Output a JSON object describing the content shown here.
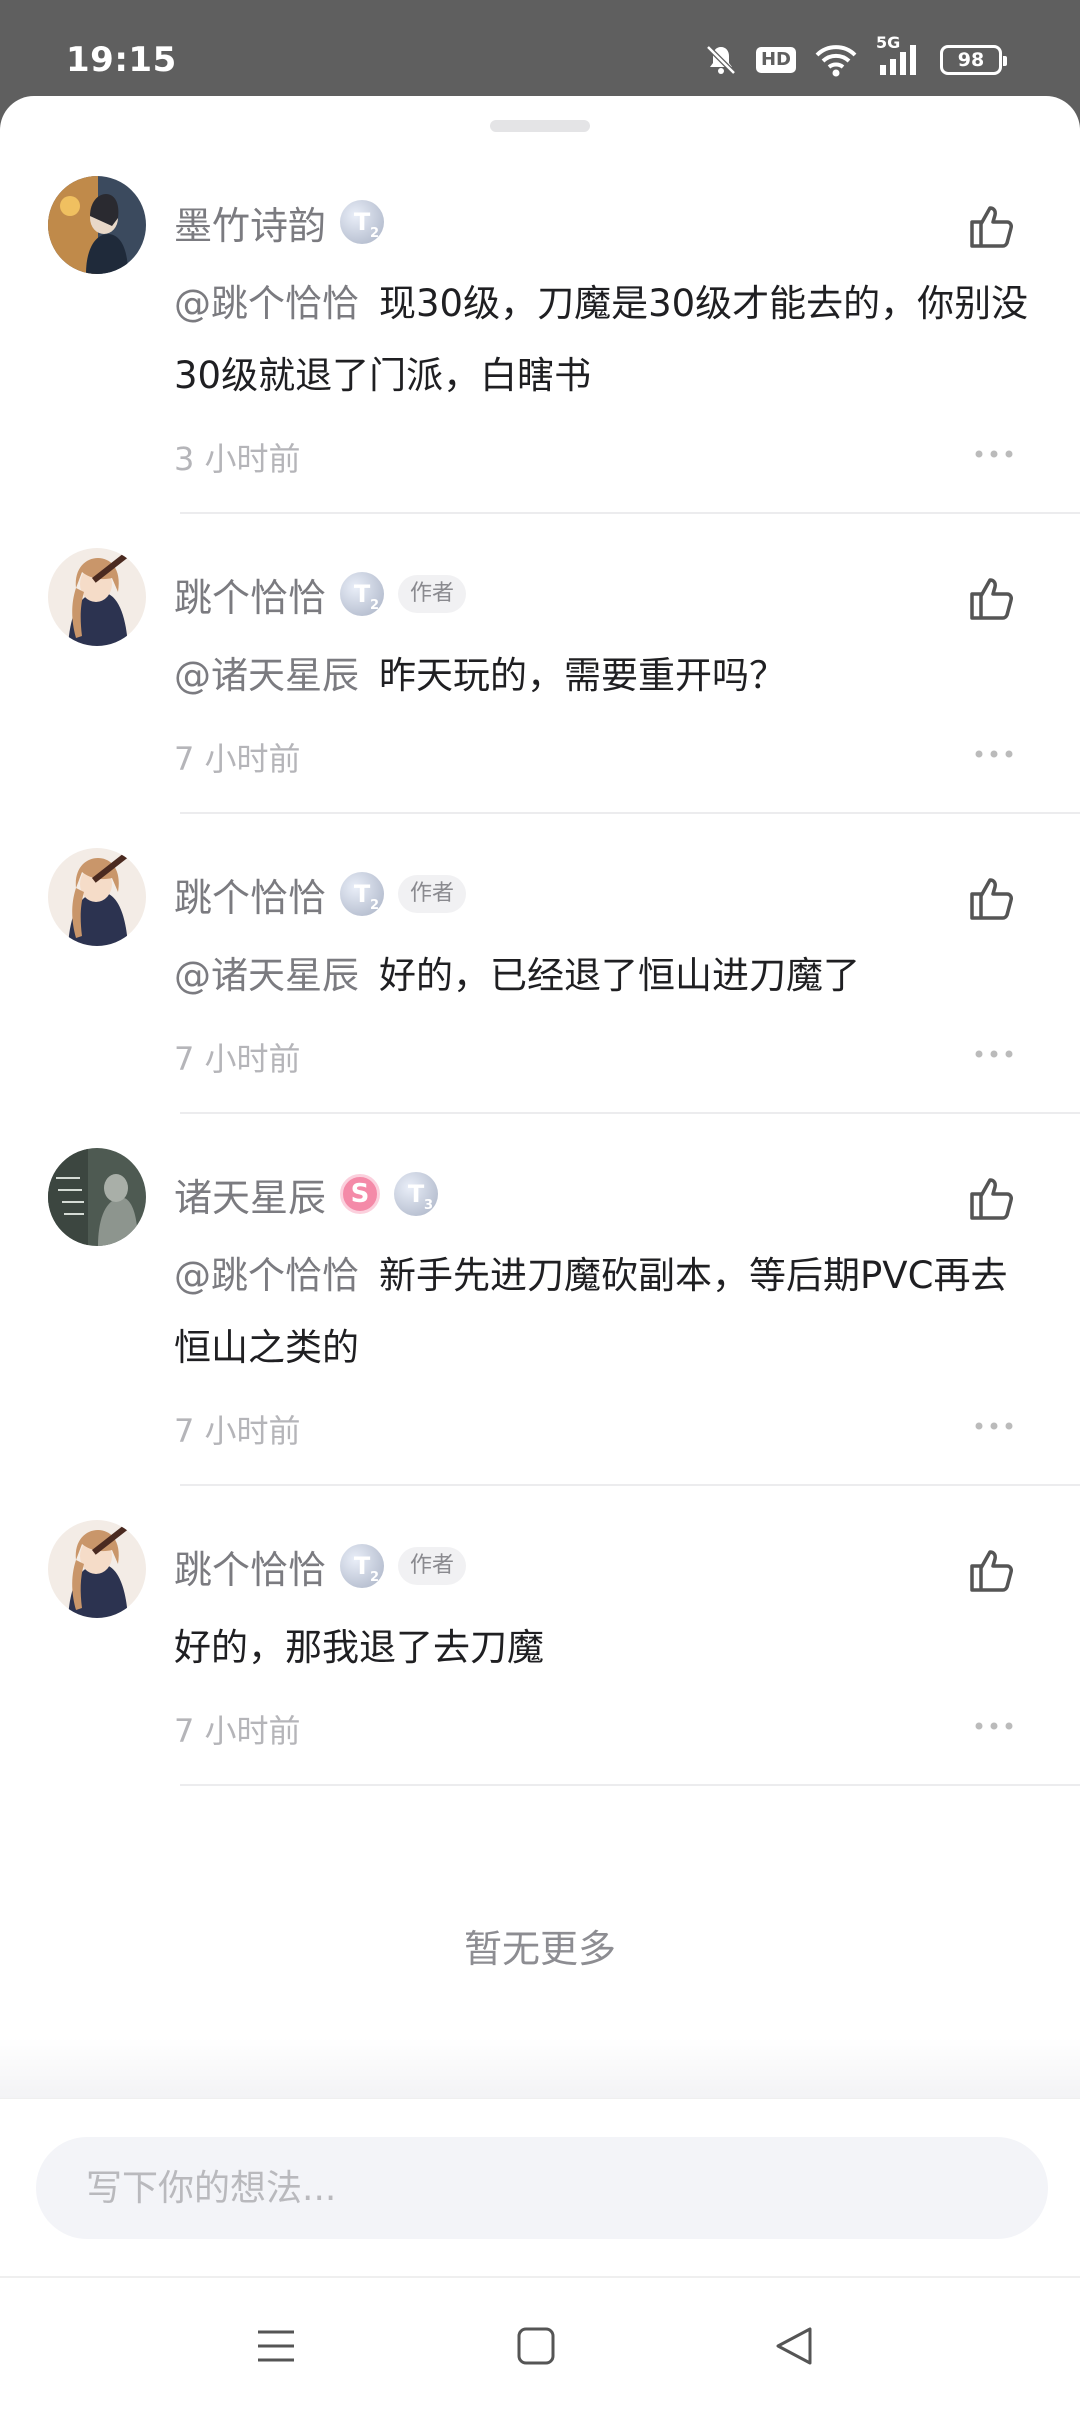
{
  "status_bar": {
    "time": "19:15",
    "icons": [
      "bell-off-icon",
      "hd-icon",
      "wifi-icon",
      "signal-5g-icon",
      "battery-icon"
    ],
    "hd_label": "HD",
    "network_label": "5G",
    "battery_level": "98"
  },
  "comments": [
    {
      "username": "墨竹诗韵",
      "level": "T",
      "level_sub": "2",
      "author_tag": "",
      "mention": "@跳个恰恰",
      "text": "现30级，刀魔是30级才能去的，你别没30级就退了门派，白瞎书",
      "time": "3 小时前"
    },
    {
      "username": "跳个恰恰",
      "level": "T",
      "level_sub": "2",
      "author_tag": "作者",
      "mention": "@诸天星辰",
      "text": "昨天玩的，需要重开吗？",
      "time": "7 小时前"
    },
    {
      "username": "跳个恰恰",
      "level": "T",
      "level_sub": "2",
      "author_tag": "作者",
      "mention": "@诸天星辰",
      "text": "好的，已经退了恒山进刀魔了",
      "time": "7 小时前"
    },
    {
      "username": "诸天星辰",
      "s_badge": "S",
      "level": "T",
      "level_sub": "3",
      "author_tag": "",
      "mention": "@跳个恰恰",
      "text": "新手先进刀魔砍副本，等后期PVC再去恒山之类的",
      "time": "7 小时前"
    },
    {
      "username": "跳个恰恰",
      "level": "T",
      "level_sub": "2",
      "author_tag": "作者",
      "mention": "",
      "text": "好的，那我退了去刀魔",
      "time": "7 小时前"
    }
  ],
  "footer": {
    "no_more": "暂无更多"
  },
  "input": {
    "placeholder": "写下你的想法..."
  },
  "nav": {
    "icons": [
      "menu-icon",
      "home-square-icon",
      "back-triangle-icon"
    ]
  },
  "colors": {
    "accent_text": "#7b7b80",
    "badge_pink": "#f48aa8",
    "background_status": "#5f5f5f"
  }
}
